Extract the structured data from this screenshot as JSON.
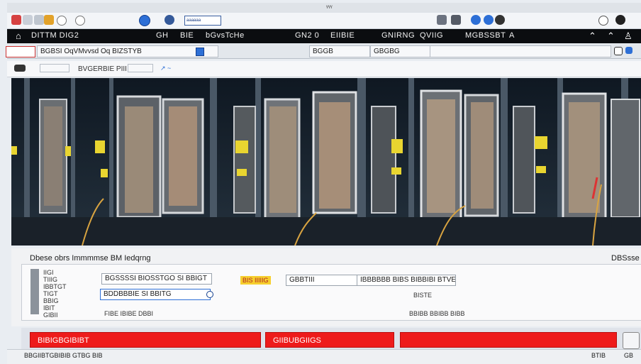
{
  "window": {
    "title": "ᵞᵞᵞ"
  },
  "toolbar": {
    "address": "ᵃᵃᵃᵃᵃᵃ",
    "icons": [
      "back-icon",
      "forward-icon",
      "home-icon",
      "refresh-icon",
      "globe-icon",
      "settings-icon",
      "window-icon",
      "user-icon",
      "chat-icon",
      "info-icon",
      "close-icon"
    ]
  },
  "menubar": {
    "items": [
      "DITTM DIG2",
      "GH",
      "BIE",
      "bGvsTcHe",
      "GN2 0",
      "EIIBIE",
      "GNIRNG",
      "QVIIG",
      "MGBSSBT"
    ],
    "app_label": "A"
  },
  "subtool": {
    "segment1": "BGBSI OqVMvvsd Oq BIZSTYB",
    "segment2": "BGGB",
    "segment3": "GBGBG"
  },
  "crumb": {
    "path": "BVGERBIE PIII"
  },
  "properties": {
    "heading": "Dbese obrs Immmmse BM Iedqrng",
    "right_label": "DBSsse",
    "labels": [
      "IIGI",
      "TIIIG",
      "IBBTGT",
      "TIGT",
      "BBIG",
      "IBIT",
      "GIBII"
    ],
    "field1": "BGSSSSI BIOSSTGO SI BBIGT",
    "field2": "BDDBBBIE SI BBITG",
    "chip": "BIS IIIIIG",
    "field3_a": "GBBTIII",
    "field3_b": "IBBBBBB BIBS BIBBIBI BTVE",
    "value_right": "BISTE",
    "footer_left": "FIBE IBIBE DBBI",
    "footer_right": "BBIBB BBIBB BIBB"
  },
  "bottom": {
    "btn1": "BIBIGBGIBIBT",
    "btn2": "GIIBUBGIIGS",
    "btn3": "",
    "btn4": ""
  },
  "status": {
    "left": "BBGIIBTGBIBIB GTBG BIB",
    "right_a": "BTIB",
    "right_b": "GB"
  },
  "colors": {
    "accent_red": "#ee1b1b",
    "menubar": "#0b0d10",
    "chip_yellow": "#f6cf2e",
    "link_blue": "#2d6fd6"
  }
}
